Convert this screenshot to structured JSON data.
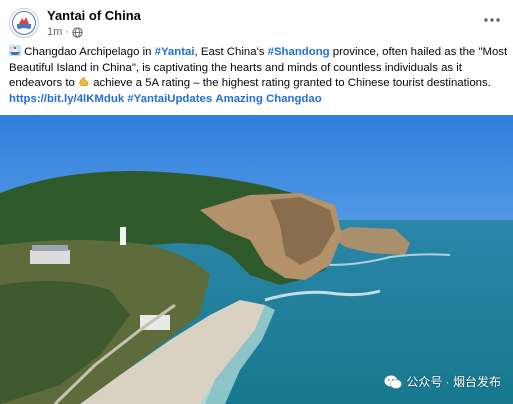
{
  "page": {
    "name": "Yantai of China",
    "time": "1m",
    "dot": "·"
  },
  "post": {
    "line1": {
      "t1": " Changdao Archipelago in ",
      "tag1": "#Yantai",
      "t2": ", East China's ",
      "tag2": "#Shandong",
      "t3": " province, often hailed as the \"Most"
    },
    "line2": "Beautiful Island in China\", is captivating the hearts and minds of countless individuals as it",
    "line3": {
      "t1": "endeavors to ",
      "t2": " achieve a 5A rating – the highest rating granted to Chinese tourist destinations."
    },
    "line4": {
      "link": "https://bit.ly/4lKMduk",
      "tag1": "#YantaiUpdates",
      "tag2": "Amazing Changdao"
    }
  },
  "watermark": {
    "text": "公众号 · 烟台发布"
  },
  "icons": {
    "avatar": "yantai-logo-icon",
    "visibility": "globe-icon",
    "menu": "more-horizontal-icon",
    "emoji1": "ship-emoji-icon",
    "emoji2": "flexed-arm-emoji-icon",
    "watermark": "wechat-icon"
  },
  "colors": {
    "link": "#216fdb",
    "meta_text": "#65676b",
    "sea": "#1f8aa8",
    "sky": "#3f8ee6"
  }
}
